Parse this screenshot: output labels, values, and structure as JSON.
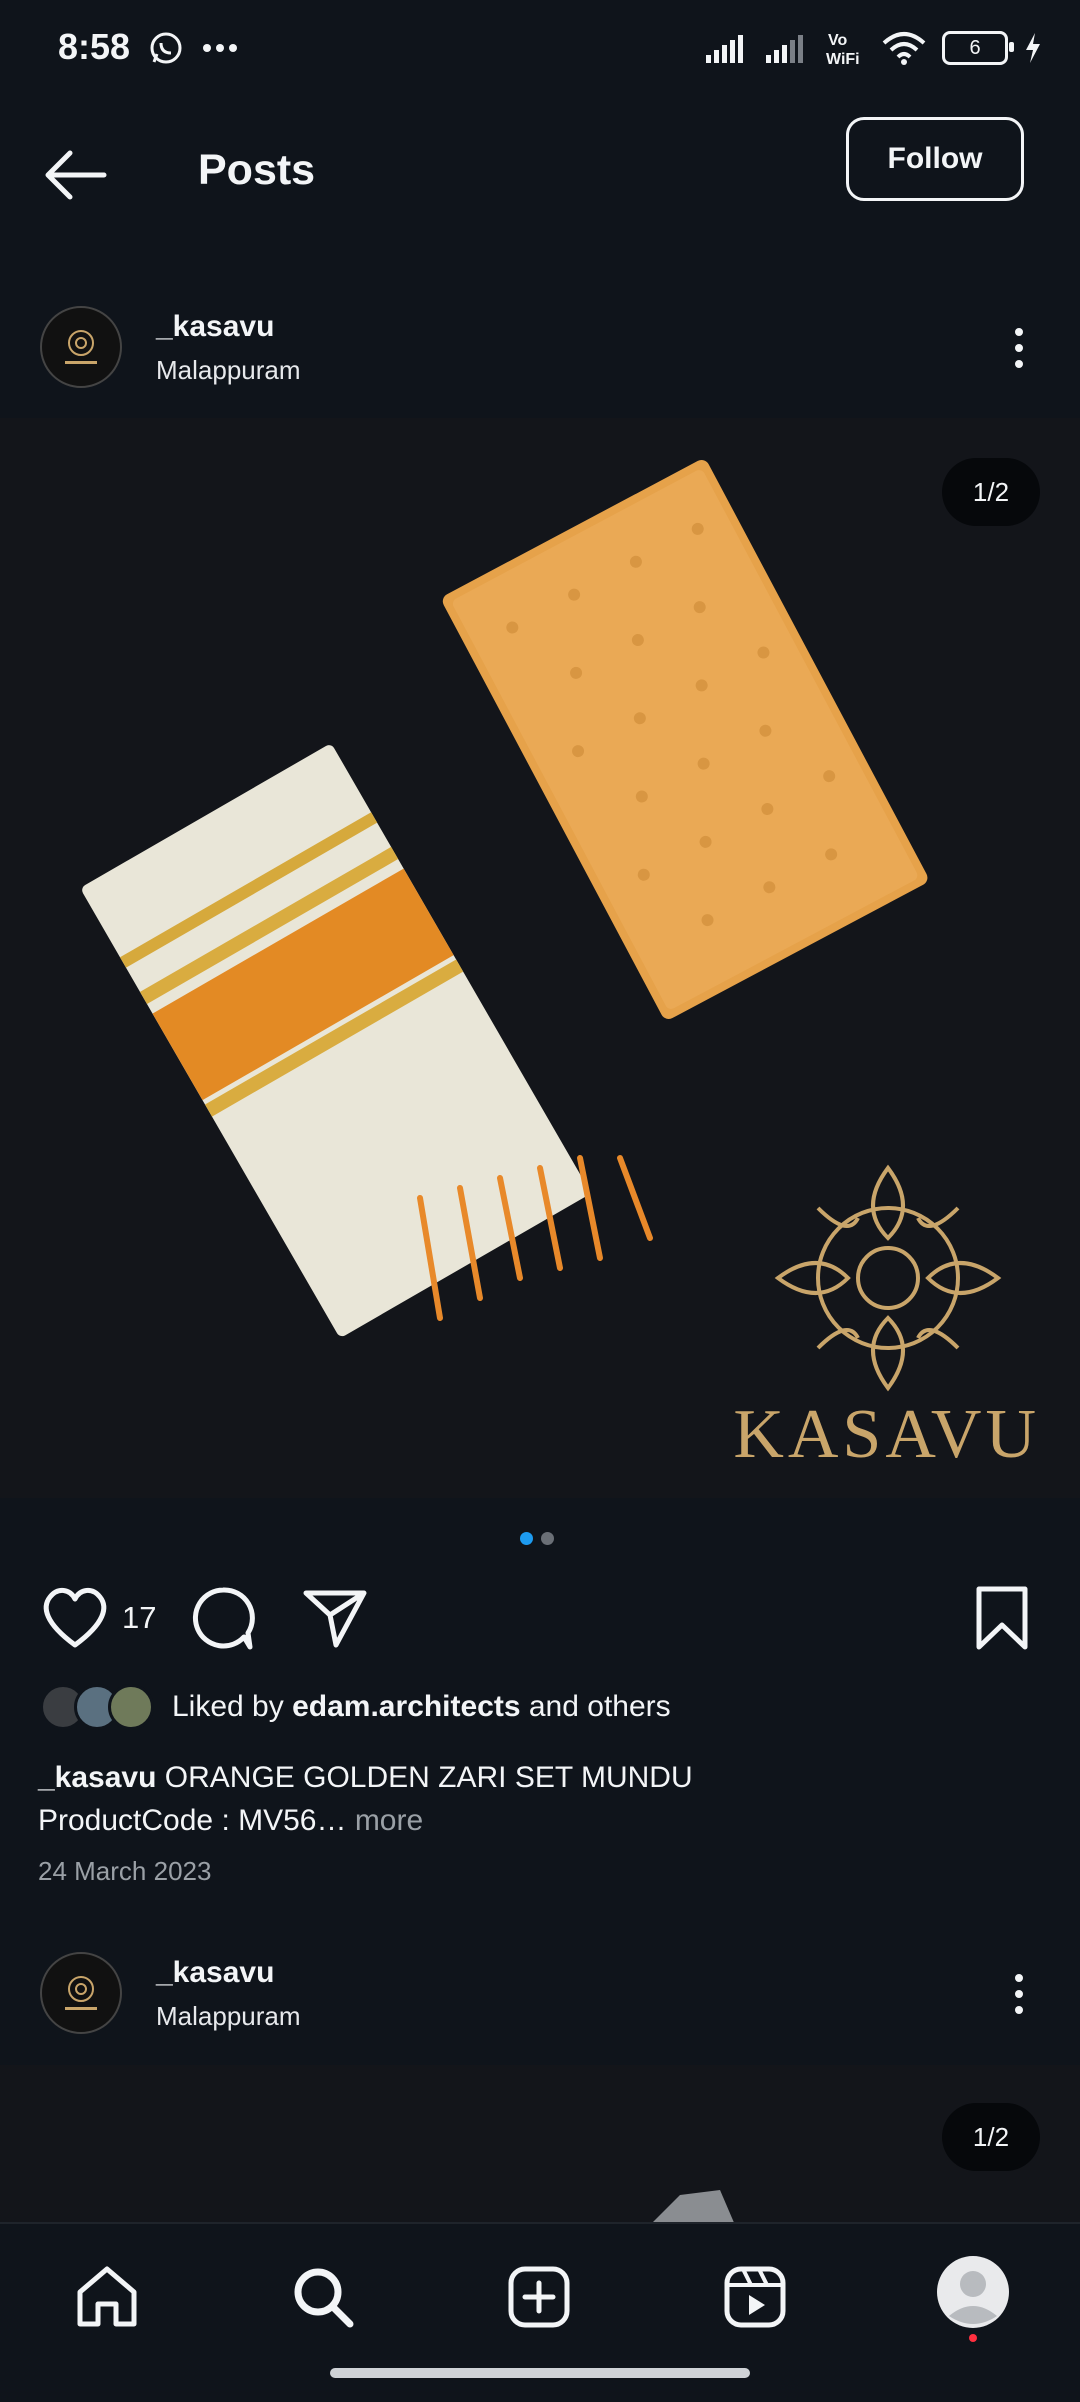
{
  "status_bar": {
    "time": "8:58",
    "battery": "6"
  },
  "header": {
    "title": "Posts",
    "follow_label": "Follow"
  },
  "post1": {
    "username": "_kasavu",
    "location": "Malappuram",
    "counter": "1/2",
    "brand_text": "KASAVU",
    "like_count": "17",
    "liked_by_prefix": "Liked by ",
    "liked_by_user": "edam.architects",
    "liked_by_suffix": " and others",
    "caption_user": "_kasavu",
    "caption_line1": " ORANGE GOLDEN ZARI SET MUNDU",
    "caption_line2": "ProductCode : MV56…",
    "caption_more": " more",
    "date": "24 March 2023",
    "carousel_pages": 2,
    "carousel_active": 1
  },
  "post2": {
    "username": "_kasavu",
    "location": "Malappuram",
    "counter": "1/2"
  },
  "icons": {
    "back": "arrow-left-icon",
    "like": "heart-icon",
    "comment": "comment-icon",
    "share": "send-icon",
    "save": "bookmark-icon",
    "home": "home-icon",
    "search": "search-icon",
    "create": "plus-square-icon",
    "reels": "reels-icon",
    "profile": "profile-avatar"
  },
  "colors": {
    "background": "#0f141b",
    "accent": "#1d9bf0",
    "gold": "#c9a56a",
    "orange": "#e8892a"
  }
}
